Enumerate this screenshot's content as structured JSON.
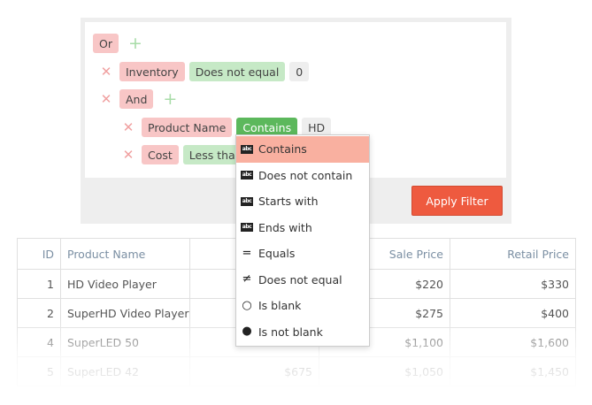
{
  "filter": {
    "root_group": "Or",
    "condition1": {
      "field": "Inventory",
      "operator": "Does not equal",
      "value": "0"
    },
    "group2": {
      "label": "And"
    },
    "condition2": {
      "field": "Product Name",
      "operator": "Contains",
      "value": "HD"
    },
    "condition3": {
      "field": "Cost",
      "operator": "Less than"
    },
    "apply_label": "Apply Filter"
  },
  "dropdown": {
    "selected": "Contains",
    "options": [
      {
        "label": "Contains",
        "icon": "abc-contains-icon",
        "glyph": "abc"
      },
      {
        "label": "Does not contain",
        "icon": "abc-not-contains-icon",
        "glyph": "abc"
      },
      {
        "label": "Starts with",
        "icon": "abc-starts-icon",
        "glyph": "abc"
      },
      {
        "label": "Ends with",
        "icon": "abc-ends-icon",
        "glyph": "abc"
      },
      {
        "label": "Equals",
        "icon": "equals-icon",
        "glyph": "="
      },
      {
        "label": "Does not equal",
        "icon": "not-equal-icon",
        "glyph": "≠"
      },
      {
        "label": "Is blank",
        "icon": "circle-outline-icon",
        "glyph": "○"
      },
      {
        "label": "Is not blank",
        "icon": "circle-filled-icon",
        "glyph": "●"
      }
    ]
  },
  "grid": {
    "columns": [
      "ID",
      "Product Name",
      "",
      "Sale Price",
      "Retail Price"
    ],
    "rows": [
      {
        "id": "1",
        "name": "HD Video Player",
        "cost": "",
        "sale": "$220",
        "retail": "$330"
      },
      {
        "id": "2",
        "name": "SuperHD Video Player",
        "cost": "",
        "sale": "$275",
        "retail": "$400"
      },
      {
        "id": "4",
        "name": "SuperLED 50",
        "cost": "",
        "sale": "$1,100",
        "retail": "$1,600"
      },
      {
        "id": "5",
        "name": "SuperLED 42",
        "cost": "$675",
        "sale": "$1,050",
        "retail": "$1,450"
      }
    ]
  },
  "colors": {
    "apply_button": "#ee5a3f",
    "selected_option": "#f9b0a0",
    "active_operator": "#5cb85c",
    "field_chip": "#f8c6c6",
    "operator_chip": "#c6e9c6"
  }
}
